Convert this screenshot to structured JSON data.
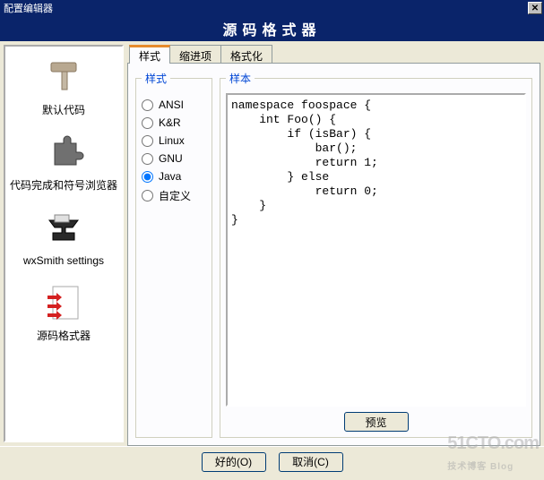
{
  "titlebar": {
    "title": "配置编辑器"
  },
  "header": {
    "title": "源码格式器"
  },
  "sidebar": {
    "items": [
      {
        "label": "默认代码"
      },
      {
        "label": "代码完成和符号浏览器"
      },
      {
        "label": "wxSmith settings"
      },
      {
        "label": "源码格式器"
      }
    ]
  },
  "tabs": [
    {
      "label": "样式"
    },
    {
      "label": "缩进项"
    },
    {
      "label": "格式化"
    }
  ],
  "style_group": {
    "legend": "样式",
    "options": [
      {
        "label": "ANSI"
      },
      {
        "label": "K&R"
      },
      {
        "label": "Linux"
      },
      {
        "label": "GNU"
      },
      {
        "label": "Java"
      },
      {
        "label": "自定义"
      }
    ],
    "selected": "Java"
  },
  "sample_group": {
    "legend": "样本",
    "code": "namespace foospace {\n    int Foo() {\n        if (isBar) {\n            bar();\n            return 1;\n        } else\n            return 0;\n    }\n}",
    "preview_label": "预览"
  },
  "footer": {
    "ok": "好的(O)",
    "cancel": "取消(C)"
  },
  "watermark": {
    "main": "51CTO.com",
    "sub": "技术博客 Blog"
  }
}
